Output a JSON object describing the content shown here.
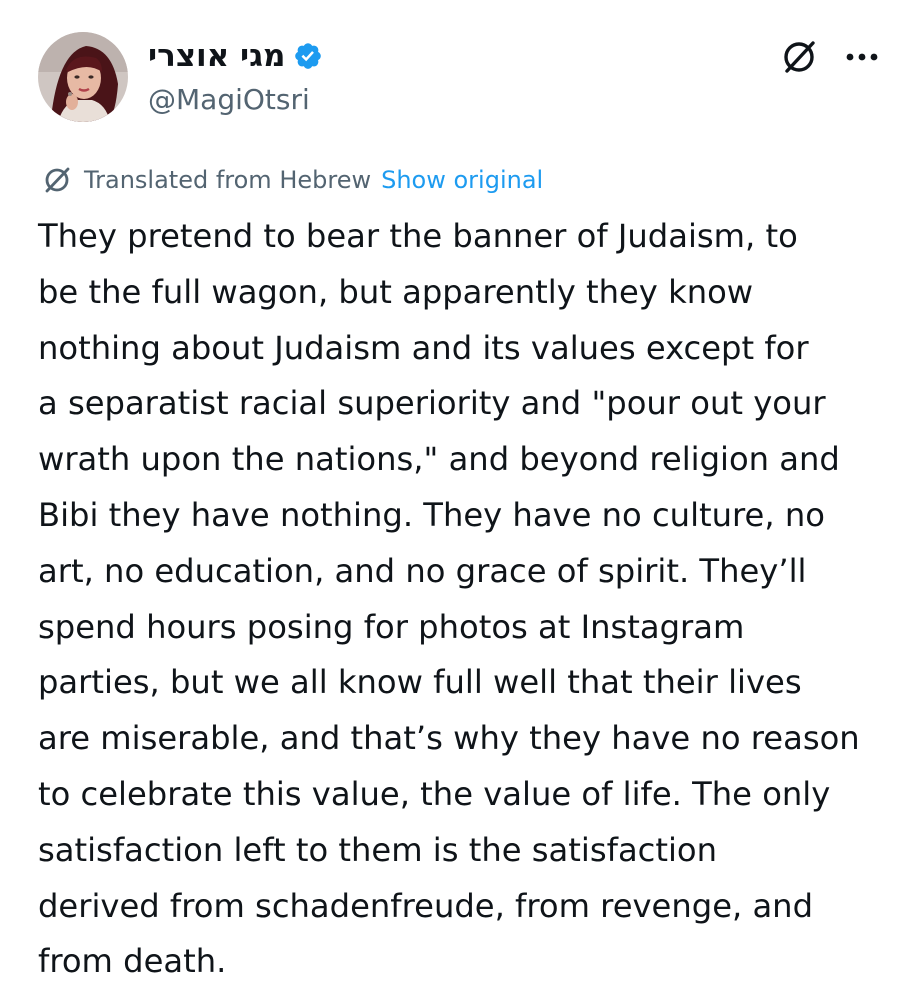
{
  "author": {
    "display_name": "מגי אוצרי",
    "handle": "@MagiOtsri",
    "verified": true,
    "avatar_icon": "profile-photo",
    "verified_icon": "verified-badge-icon",
    "verified_color": "#1d9bf0"
  },
  "header": {
    "translate_icon": "translate-icon",
    "more_icon": "more-options-icon"
  },
  "translation": {
    "label": "Translated from Hebrew",
    "show_original": "Show original",
    "icon": "translate-icon",
    "link_color": "#1d9bf0"
  },
  "tweet": {
    "text": "They pretend to bear the banner of Judaism, to\nbe the full wagon, but apparently they know\nnothing about Judaism and its values except for\na separatist racial superiority and \"pour out your\nwrath upon the nations,\" and beyond religion and\nBibi they have nothing. They have no culture, no\nart, no education, and no grace of spirit. They’ll\nspend hours posing for photos at Instagram\nparties, but we all know full well that their lives\nare miserable, and that’s why they have no reason\nto celebrate this value, the value of life. The only\nsatisfaction left to them is the satisfaction\nderived from schadenfreude, from revenge, and\nfrom death."
  }
}
